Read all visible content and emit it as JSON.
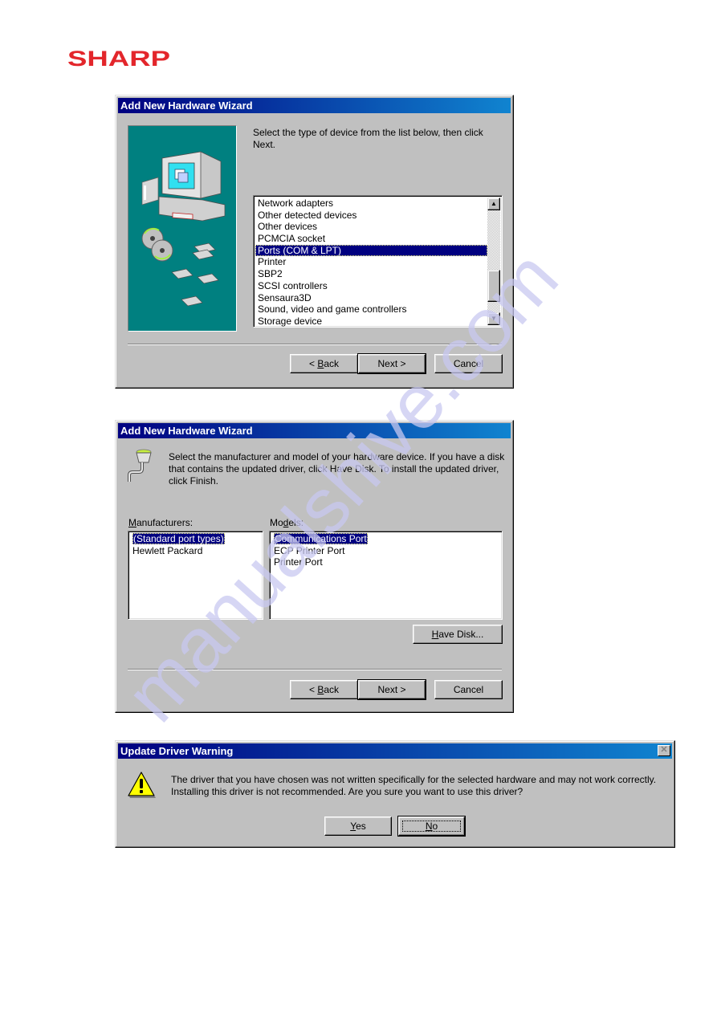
{
  "brand": {
    "logo_text": "SHARP",
    "color": "#e3262b"
  },
  "watermark": {
    "text": "manualshive.com",
    "color": "#c8c8f0"
  },
  "dialog1": {
    "title": "Add New Hardware Wizard",
    "instruction": "Select the type of device from the list below, then click Next.",
    "device_types": [
      "Network adapters",
      "Other detected devices",
      "Other devices",
      "PCMCIA socket",
      "Ports (COM & LPT)",
      "Printer",
      "SBP2",
      "SCSI controllers",
      "Sensaura3D",
      "Sound, video and game controllers",
      "Storage device"
    ],
    "selected_index": 4,
    "scrollbar": {
      "up_icon": "▲",
      "down_icon": "▼"
    },
    "buttons": {
      "back_prefix": "< ",
      "back_mnemonic": "B",
      "back_rest": "ack",
      "next": "Next >",
      "cancel": "Cancel"
    }
  },
  "dialog2": {
    "title": "Add New Hardware Wizard",
    "instruction": "Select the manufacturer and model of your hardware device. If you have a disk that contains the updated driver, click Have Disk. To install the updated driver, click Finish.",
    "manufacturers_label_mnemonic": "M",
    "manufacturers_label_rest": "anufacturers:",
    "models_label_pre": "Mo",
    "models_label_mnemonic": "d",
    "models_label_rest": "els:",
    "manufacturers": [
      "(Standard port types)",
      "Hewlett Packard"
    ],
    "manufacturers_selected": 0,
    "models": [
      "Communications Port",
      "ECP Printer Port",
      "Printer Port"
    ],
    "models_selected": 0,
    "buttons": {
      "have_disk_mnemonic": "H",
      "have_disk_rest": "ave Disk...",
      "back_prefix": "< ",
      "back_mnemonic": "B",
      "back_rest": "ack",
      "next": "Next >",
      "cancel": "Cancel"
    }
  },
  "dialog3": {
    "title": "Update Driver Warning",
    "message_line1": "The driver that you have chosen was not written specifically for the selected hardware and may not work correctly.",
    "message_line2": "Installing this driver is not recommended.  Are you sure you want to use this driver?",
    "close_icon": "✕",
    "buttons": {
      "yes_mnemonic": "Y",
      "yes_rest": "es",
      "no_mnemonic": "N",
      "no_rest": "o"
    }
  }
}
